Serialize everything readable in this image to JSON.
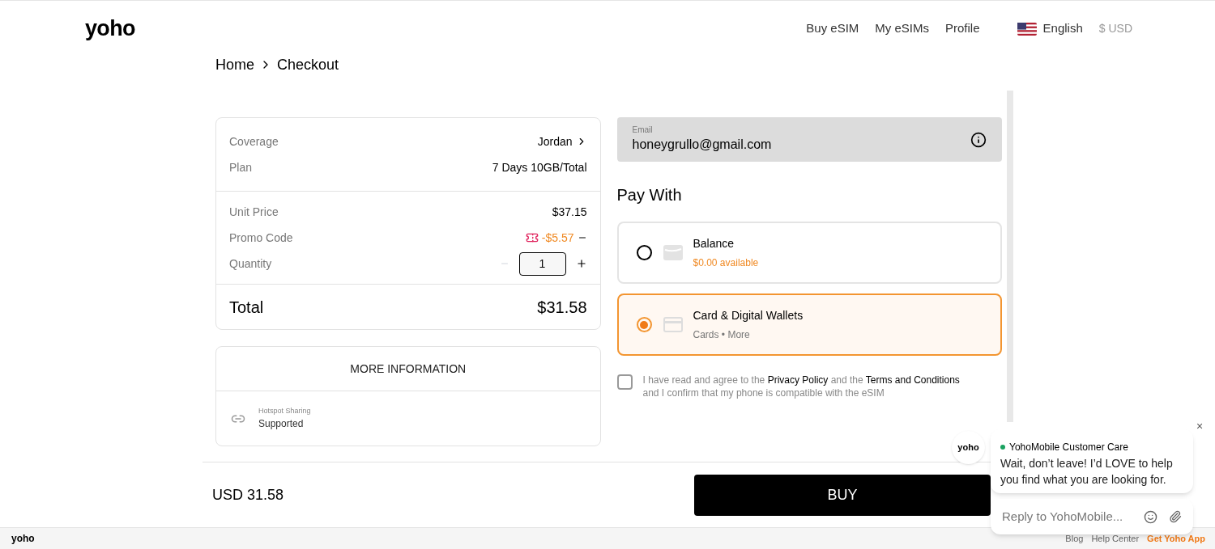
{
  "header": {
    "logo": "yoho",
    "nav": [
      {
        "label": "Buy eSIM"
      },
      {
        "label": "My eSIMs"
      },
      {
        "label": "Profile"
      }
    ],
    "language": "English",
    "currency": "$ USD"
  },
  "breadcrumb": [
    "Home",
    "Checkout"
  ],
  "summary": {
    "groups": [
      [
        {
          "kind": "link",
          "label": "Coverage",
          "value": "Jordan"
        },
        {
          "kind": "text",
          "label": "Plan",
          "value": "7 Days 10GB/Total"
        }
      ],
      [
        {
          "kind": "text",
          "label": "Unit Price",
          "value": "$37.15"
        },
        {
          "kind": "promo",
          "label": "Promo Code",
          "value": "-$5.57"
        },
        {
          "kind": "quantity",
          "label": "Quantity",
          "value": "1",
          "minus_disabled": true
        }
      ]
    ],
    "total": {
      "label": "Total",
      "value": "$31.58"
    }
  },
  "more_info": {
    "title": "MORE INFORMATION",
    "features": [
      {
        "label": "Hotspot Sharing",
        "value": "Supported"
      }
    ]
  },
  "email": {
    "label": "Email",
    "value": "honeygrullo@gmail.com"
  },
  "pay_with": {
    "title": "Pay With",
    "options": [
      {
        "kind": "balance",
        "title": "Balance",
        "subtitle": "$0.00 available",
        "selected": false
      },
      {
        "kind": "card",
        "title": "Card & Digital Wallets",
        "subtitle": "Cards • More",
        "selected": true
      }
    ]
  },
  "agreement": {
    "checked": false,
    "parts": [
      {
        "kind": "text",
        "text": "I have read and agree to the "
      },
      {
        "kind": "link",
        "text": "Privacy Policy"
      },
      {
        "kind": "text",
        "text": " and the "
      },
      {
        "kind": "link",
        "text": "Terms and Conditions"
      },
      {
        "kind": "text",
        "text": " and I confirm that my phone is compatible with the eSIM"
      }
    ]
  },
  "checkout_bar": {
    "total": "USD 31.58",
    "button": "BUY"
  },
  "chat": {
    "avatar": "yoho",
    "agent": "YohoMobile Customer Care",
    "online": true,
    "message": "Wait, don’t leave! I’d LOVE to help you find what you are looking for.",
    "placeholder": "Reply to YohoMobile...",
    "close": "×"
  },
  "footer": {
    "logo": "yoho",
    "links": [
      {
        "kind": "plain",
        "label": "Blog"
      },
      {
        "kind": "plain",
        "label": "Help Center"
      },
      {
        "kind": "highlight",
        "label": "Get Yoho App"
      }
    ]
  }
}
